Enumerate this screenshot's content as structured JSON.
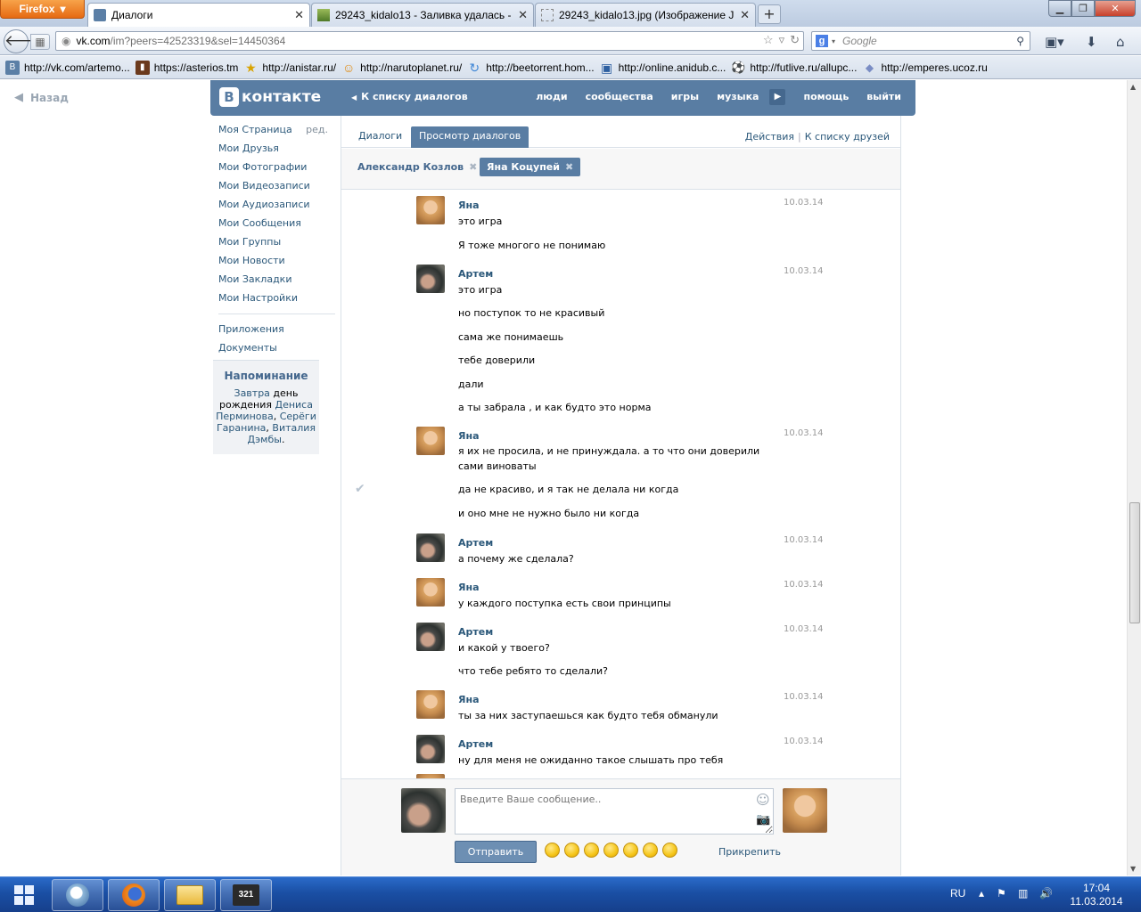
{
  "browser": {
    "menu_label": "Firefox",
    "tabs": [
      {
        "title": "Диалоги",
        "active": true
      },
      {
        "title": "29243_kidalo13 - Заливка удалась - ...",
        "active": false
      },
      {
        "title": "29243_kidalo13.jpg (Изображение JP...",
        "active": false
      }
    ],
    "new_tab": "+",
    "url_domain": "vk.com",
    "url_rest": "/im?peers=42523319&sel=14450364",
    "search_placeholder": "Google",
    "bookmarks": [
      {
        "label": "http://vk.com/artemo...",
        "icon": "vk-icon",
        "color": "#5b7fa6",
        "glyph": "В"
      },
      {
        "label": "https://asterios.tm",
        "icon": "asterios-icon",
        "color": "#6b3a1d",
        "glyph": "▮"
      },
      {
        "label": "http://anistar.ru/",
        "icon": "star-icon",
        "color": "#d9a300",
        "glyph": "★"
      },
      {
        "label": "http://narutoplanet.ru/",
        "icon": "naruto-icon",
        "color": "#e08a10",
        "glyph": "☺"
      },
      {
        "label": "http://beetorrent.hom...",
        "icon": "torrent-icon",
        "color": "#3f86d6",
        "glyph": "↻"
      },
      {
        "label": "http://online.anidub.c...",
        "icon": "anidub-icon",
        "color": "#2d5fa0",
        "glyph": "▣"
      },
      {
        "label": "http://futlive.ru/allupc...",
        "icon": "football-icon",
        "color": "#333333",
        "glyph": "⚽"
      },
      {
        "label": "http://emperes.ucoz.ru",
        "icon": "ucoz-icon",
        "color": "#7a8dc4",
        "glyph": "◆"
      }
    ]
  },
  "page": {
    "back_label": "Назад",
    "header": {
      "logo_letter": "В",
      "logo_text": "контакте",
      "back_to_list": "К списку диалогов",
      "nav": [
        "люди",
        "сообщества",
        "игры",
        "музыка",
        "помощь",
        "выйти"
      ]
    },
    "sidebar": {
      "edit_label": "ред.",
      "items": [
        "Моя Страница",
        "Мои Друзья",
        "Мои Фотографии",
        "Мои Видеозаписи",
        "Мои Аудиозаписи",
        "Мои Сообщения",
        "Мои Группы",
        "Мои Новости",
        "Мои Закладки",
        "Мои Настройки"
      ],
      "extra_items": [
        "Приложения",
        "Документы"
      ]
    },
    "reminder": {
      "title": "Напоминание",
      "tomorrow": "Завтра",
      "text1": " день рождения ",
      "p1": "Дениса Перминова",
      "comma": ", ",
      "p2": "Серёги Гаранина",
      "p3": "Виталия Дэмбы",
      "dot": "."
    },
    "tabs": {
      "dialogs": "Диалоги",
      "view": "Просмотр диалогов",
      "actions": "Действия",
      "separator": "|",
      "to_friends": "К списку друзей"
    },
    "peers": [
      {
        "name": "Александр Козлов",
        "selected": false
      },
      {
        "name": "Яна Коцупей",
        "selected": true
      }
    ],
    "messages": [
      {
        "author": "Яна",
        "date": "10.03.14",
        "lines": [
          "это игра",
          "Я тоже многого не понимаю"
        ]
      },
      {
        "author": "Артем",
        "date": "10.03.14",
        "lines": [
          "это игра",
          "но поступок то не красивый",
          "сама же понимаешь",
          "тебе доверили",
          "дали",
          "а ты забрала , и как будто это норма"
        ]
      },
      {
        "author": "Яна",
        "date": "10.03.14",
        "lines": [
          "я их не просила, и не принуждала. а то что они доверили сами виноваты",
          "да не красиво, и я так не делала ни когда",
          "и оно мне не нужно было ни когда"
        ]
      },
      {
        "author": "Артем",
        "date": "10.03.14",
        "lines": [
          "а почему же сделала?"
        ]
      },
      {
        "author": "Яна",
        "date": "10.03.14",
        "lines": [
          "у каждого поступка есть свои принципы"
        ]
      },
      {
        "author": "Артем",
        "date": "10.03.14",
        "lines": [
          "и какой у твоего?",
          "что тебе ребято то сделали?"
        ]
      },
      {
        "author": "Яна",
        "date": "10.03.14",
        "lines": [
          "ты за них заступаешься как будто тебя обманули"
        ]
      },
      {
        "author": "Артем",
        "date": "10.03.14",
        "lines": [
          "ну для меня не ожиданно такое слышать про тебя"
        ]
      }
    ],
    "composer": {
      "placeholder": "Введите Ваше сообщение..",
      "send": "Отправить",
      "attach": "Прикрепить",
      "emojis": [
        "😜",
        "😆",
        "😉",
        "😚",
        "😁",
        "😳",
        "😔"
      ]
    }
  },
  "taskbar": {
    "apps": [
      "messenger-app",
      "firefox-app",
      "explorer-app",
      "media-player-app"
    ],
    "media_label": "321",
    "lang": "RU",
    "time": "17:04",
    "date": "11.03.2014"
  }
}
